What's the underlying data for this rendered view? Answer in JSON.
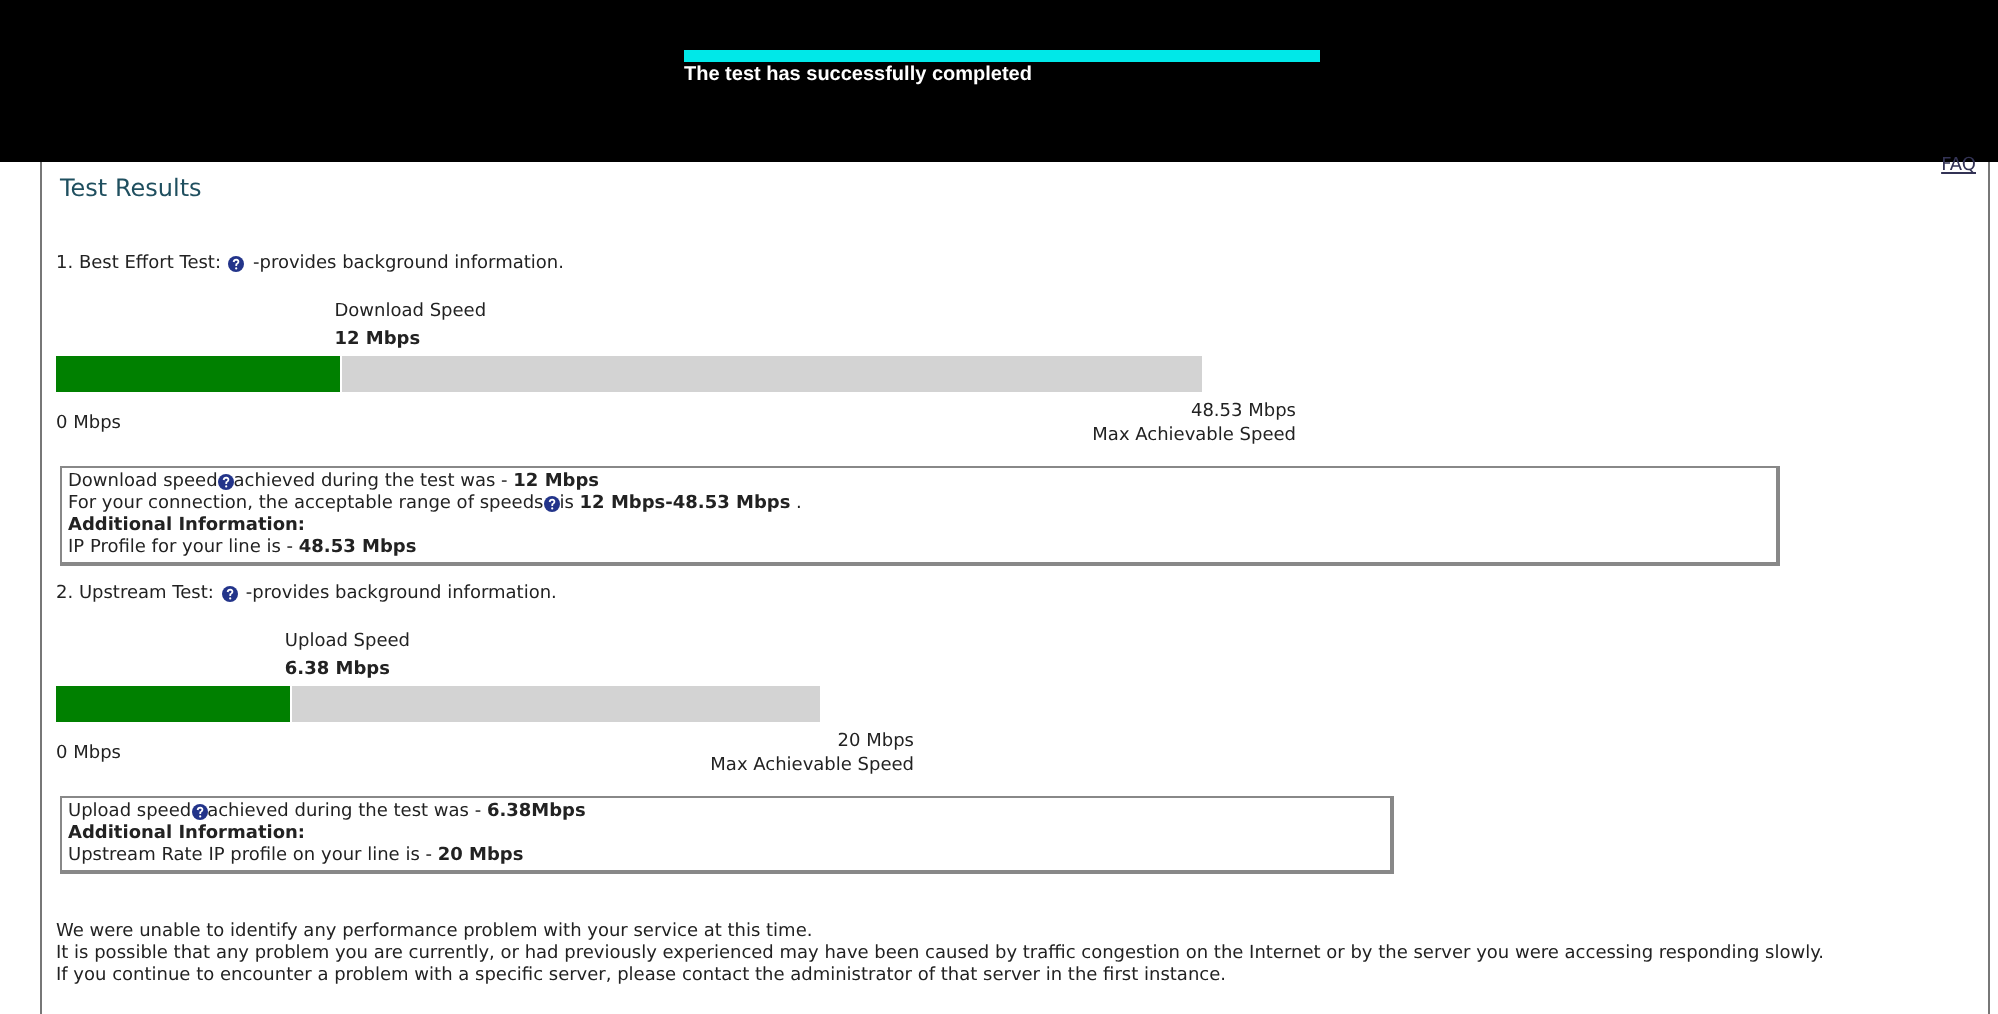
{
  "banner": {
    "progress": {
      "level": 1
    },
    "message": "The test has successfully completed"
  },
  "faq_link": "FAQ",
  "title": "Test Results",
  "tests": [
    {
      "heading": "1. Best Effort Test:",
      "heading_note": "-provides background information.",
      "gauge": {
        "label": "Download Speed",
        "value": "12 Mbps",
        "level": 0.25,
        "min": "0 Mbps",
        "max": "48.53 Mbps",
        "max_caption": "Max Achievable Speed",
        "kind": "wide"
      },
      "info": [
        {
          "kind": "help",
          "before": "Download speed",
          "after": "achieved during the test was - **12 Mbps**"
        },
        {
          "kind": "help",
          "before": "For your connection, the acceptable range of speeds",
          "after": "is **12 Mbps-48.53 Mbps** ."
        },
        {
          "kind": "heading",
          "before": "Additional Information:"
        },
        {
          "kind": "plain",
          "before": "IP Profile for your line is - **48.53 Mbps**"
        }
      ]
    },
    {
      "heading": "2. Upstream Test:",
      "heading_note": "-provides background information.",
      "gauge": {
        "label": "Upload Speed",
        "value": "6.38 Mbps",
        "level": 0.31,
        "min": "0 Mbps",
        "max": "20 Mbps",
        "max_caption": "Max Achievable Speed",
        "kind": "narrow"
      },
      "info": [
        {
          "kind": "help",
          "before": "Upload speed",
          "after": " achieved during the test was - **6.38Mbps**"
        },
        {
          "kind": "heading",
          "before": "Additional Information:"
        },
        {
          "kind": "plain",
          "before": "Upstream Rate IP profile on your line is - **20 Mbps**"
        }
      ]
    }
  ],
  "notes": [
    "We were unable to identify any performance problem with your service at this time.",
    "It is possible that any problem you are currently, or had previously experienced may have been caused by traffic congestion on the Internet or by the server you were accessing responding slowly.",
    "If you continue to encounter a problem with a specific server, please contact the administrator of that server in the first instance."
  ]
}
